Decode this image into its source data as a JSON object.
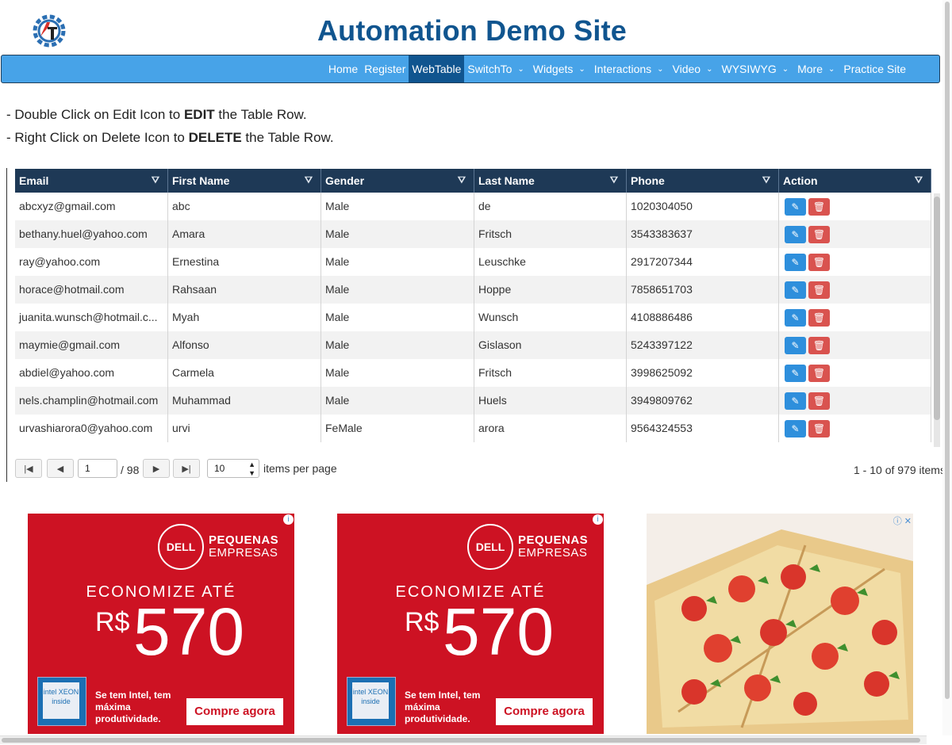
{
  "site": {
    "title": "Automation Demo Site",
    "logo_icon": "gear-logo-icon"
  },
  "nav": [
    {
      "label": "Home",
      "has_menu": false,
      "active": false
    },
    {
      "label": "Register",
      "has_menu": false,
      "active": false
    },
    {
      "label": "WebTable",
      "has_menu": false,
      "active": true
    },
    {
      "label": "SwitchTo",
      "has_menu": true,
      "active": false
    },
    {
      "label": "Widgets",
      "has_menu": true,
      "active": false
    },
    {
      "label": "Interactions",
      "has_menu": true,
      "active": false
    },
    {
      "label": "Video",
      "has_menu": true,
      "active": false
    },
    {
      "label": "WYSIWYG",
      "has_menu": true,
      "active": false
    },
    {
      "label": "More",
      "has_menu": true,
      "active": false
    },
    {
      "label": "Practice Site",
      "has_menu": false,
      "active": false
    }
  ],
  "instructions": {
    "line1": {
      "pre": "- Double Click on Edit Icon to ",
      "bold": "EDIT",
      "post": " the Table Row."
    },
    "line2": {
      "pre": "- Right Click on Delete Icon to ",
      "bold": "DELETE",
      "post": " the Table Row."
    }
  },
  "table": {
    "columns": [
      "Email",
      "First Name",
      "Gender",
      "Last Name",
      "Phone",
      "Action"
    ],
    "rows": [
      [
        "abcxyz@gmail.com",
        "abc",
        "Male",
        "de",
        "1020304050"
      ],
      [
        "bethany.huel@yahoo.com",
        "Amara",
        "Male",
        "Fritsch",
        "3543383637"
      ],
      [
        "ray@yahoo.com",
        "Ernestina",
        "Male",
        "Leuschke",
        "2917207344"
      ],
      [
        "horace@hotmail.com",
        "Rahsaan",
        "Male",
        "Hoppe",
        "7858651703"
      ],
      [
        "juanita.wunsch@hotmail.c...",
        "Myah",
        "Male",
        "Wunsch",
        "4108886486"
      ],
      [
        "maymie@gmail.com",
        "Alfonso",
        "Male",
        "Gislason",
        "5243397122"
      ],
      [
        "abdiel@yahoo.com",
        "Carmela",
        "Male",
        "Fritsch",
        "3998625092"
      ],
      [
        "nels.champlin@hotmail.com",
        "Muhammad",
        "Male",
        "Huels",
        "3949809762"
      ],
      [
        "urvashiarora0@yahoo.com",
        "urvi",
        "FeMale",
        "arora",
        "9564324553"
      ]
    ]
  },
  "pager": {
    "page": "1",
    "total_pages": "/ 98",
    "page_size": "10",
    "items_per_page_label": "items per page",
    "summary": "1 - 10 of 979 items"
  },
  "ads": {
    "dell": {
      "brand": "DELL",
      "line1": "PEQUENAS",
      "line2": "EMPRESAS",
      "headline": "ECONOMIZE ATÉ",
      "currency": "R$",
      "price": "570",
      "intel_badge": "intel XEON inside",
      "tagline": "Se tem Intel, tem máxima produtividade.",
      "cta": "Compre agora"
    }
  },
  "colors": {
    "title": "#10558f",
    "navbar": "#47a3e8",
    "nav_active": "#10558f",
    "table_header": "#1e3956",
    "edit_button": "#2e8fdc",
    "delete_button": "#d9534f",
    "ad_red": "#cd1223"
  }
}
